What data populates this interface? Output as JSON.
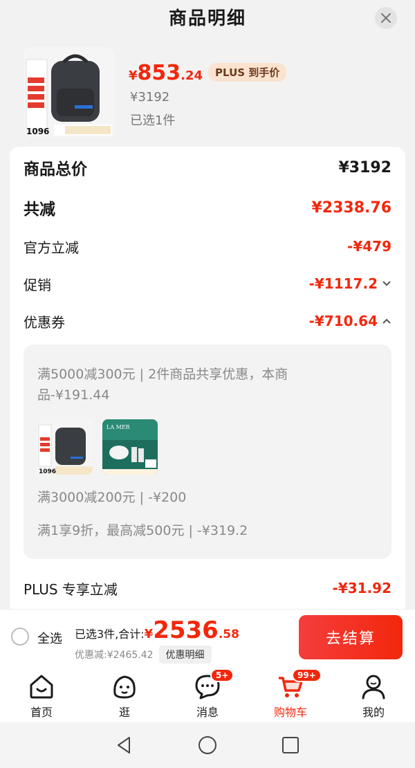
{
  "header": {
    "title": "商品明细"
  },
  "product": {
    "price_yen": "¥",
    "price_int": "853",
    "price_dec": ".24",
    "plus_badge": "PLUS 到手价",
    "original_price": "¥3192",
    "quantity": "已选1件",
    "image_text": "1096"
  },
  "summary": {
    "total_label": "商品总价",
    "total_value": "¥3192",
    "reduce_label": "共减",
    "reduce_value": "¥2338.76",
    "official_label": "官方立减",
    "official_value": "-¥479",
    "promo_label": "促销",
    "promo_value": "-¥1117.2",
    "coupon_label": "优惠券",
    "coupon_value": "-¥710.64"
  },
  "coupons": {
    "line1": "满5000减300元 | 2件商品共享优惠，本商",
    "line1b": "品-¥191.44",
    "line2": "满3000减200元 | -¥200",
    "line3": "满1享9折，最高减500元 | -¥319.2",
    "thumb1_text": "1096",
    "thumb2_text": "LA MER"
  },
  "plus_row": {
    "label": "PLUS 专享立减",
    "value": "-¥31.92"
  },
  "bottom": {
    "select_all": "全选",
    "selected_label": "已选3件,合计:",
    "sum_yen": "¥",
    "sum_int": "2536",
    "sum_dec": ".58",
    "discount_text": "优惠减:¥2465.42",
    "detail_chip": "优惠明细",
    "checkout": "去结算"
  },
  "tabs": [
    {
      "label": "首页",
      "icon": "home-icon"
    },
    {
      "label": "逛",
      "icon": "explore-face-icon"
    },
    {
      "label": "消息",
      "icon": "message-icon",
      "badge": "5+"
    },
    {
      "label": "购物车",
      "icon": "cart-icon",
      "badge": "99+",
      "active": true
    },
    {
      "label": "我的",
      "icon": "profile-icon"
    }
  ],
  "colors": {
    "accent": "#f2270c",
    "plus_badge_bg": "#fbe3cf"
  }
}
